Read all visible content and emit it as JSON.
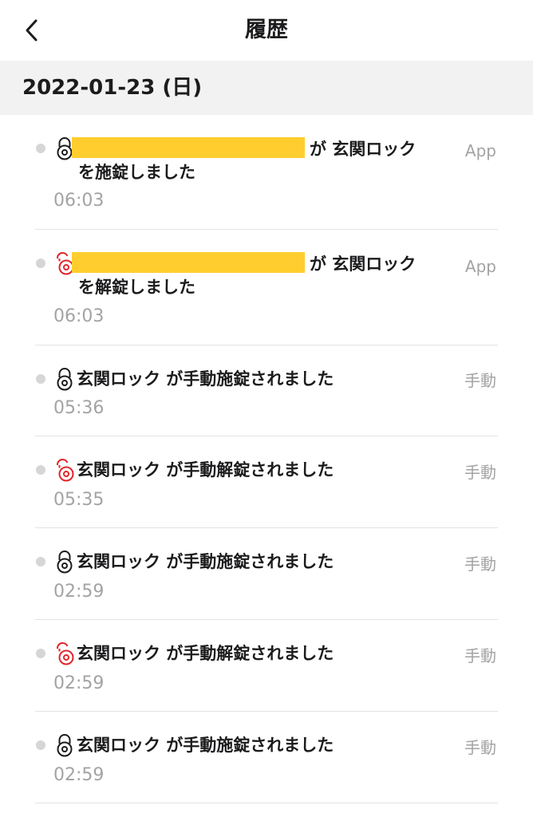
{
  "header": {
    "title": "履歴",
    "back_icon": "chevron-left-icon"
  },
  "date_section": {
    "label": "2022-01-23 (日)"
  },
  "colors": {
    "locked_icon": "#1c1c1e",
    "unlocked_icon": "#e0262b",
    "redaction": "#ffce2e"
  },
  "entries": [
    {
      "type": "locked",
      "icon": "lock-closed-icon",
      "message_after": "が 玄関ロック",
      "message_cont": "を施錠しました",
      "time": "06:03",
      "source": "App"
    },
    {
      "type": "unlocked",
      "icon": "lock-open-icon",
      "message_after": "が 玄関ロック",
      "message_cont": "を解錠しました",
      "time": "06:03",
      "source": "App"
    },
    {
      "type": "locked",
      "icon": "lock-closed-icon",
      "message": "玄関ロック が手動施錠されました",
      "time": "05:36",
      "source": "手動"
    },
    {
      "type": "unlocked",
      "icon": "lock-open-icon",
      "message": "玄関ロック が手動解錠されました",
      "time": "05:35",
      "source": "手動"
    },
    {
      "type": "locked",
      "icon": "lock-closed-icon",
      "message": "玄関ロック が手動施錠されました",
      "time": "02:59",
      "source": "手動"
    },
    {
      "type": "unlocked",
      "icon": "lock-open-icon",
      "message": "玄関ロック が手動解錠されました",
      "time": "02:59",
      "source": "手動"
    },
    {
      "type": "locked",
      "icon": "lock-closed-icon",
      "message": "玄関ロック が手動施錠されました",
      "time": "02:59",
      "source": "手動"
    }
  ]
}
